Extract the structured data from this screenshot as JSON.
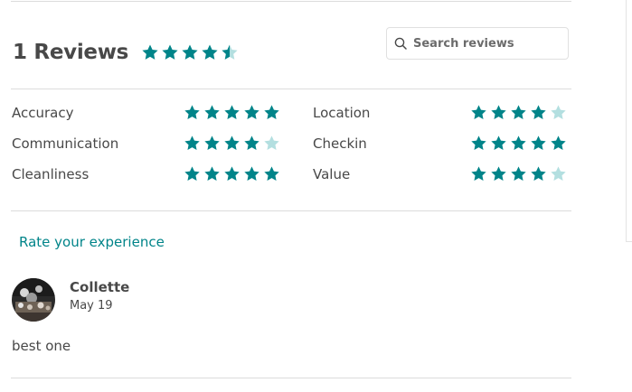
{
  "header": {
    "title": "1 Reviews",
    "overall_rating": 4.5
  },
  "search": {
    "placeholder": "Search reviews",
    "value": ""
  },
  "ratings": [
    {
      "label": "Accuracy",
      "value": 5
    },
    {
      "label": "Location",
      "value": 4
    },
    {
      "label": "Communication",
      "value": 4
    },
    {
      "label": "Checkin",
      "value": 5
    },
    {
      "label": "Cleanliness",
      "value": 5
    },
    {
      "label": "Value",
      "value": 4
    }
  ],
  "rate_link": "Rate your experience",
  "review": {
    "author": "Collette",
    "date": "May 19",
    "text": "best one"
  },
  "colors": {
    "star_filled": "#008489",
    "star_empty": "#b3dfe0",
    "accent": "#008489"
  },
  "icons": {
    "search": "search-icon",
    "star": "star-icon"
  }
}
